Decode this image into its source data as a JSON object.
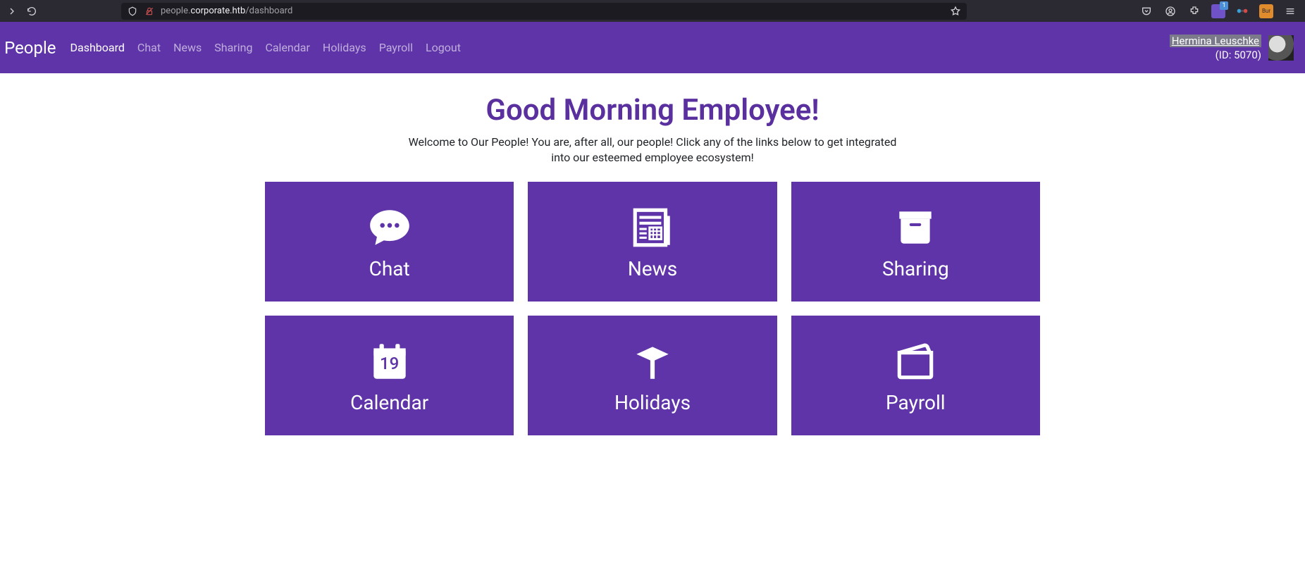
{
  "browser": {
    "url_prefix": "people.",
    "url_host": "corporate.htb",
    "url_path": "/dashboard",
    "ext_badge_count": "1",
    "ext_orange_label": "Bur"
  },
  "nav": {
    "brand": "r People",
    "links": [
      {
        "label": "Dashboard",
        "active": true
      },
      {
        "label": "Chat",
        "active": false
      },
      {
        "label": "News",
        "active": false
      },
      {
        "label": "Sharing",
        "active": false
      },
      {
        "label": "Calendar",
        "active": false
      },
      {
        "label": "Holidays",
        "active": false
      },
      {
        "label": "Payroll",
        "active": false
      },
      {
        "label": "Logout",
        "active": false
      }
    ],
    "user": {
      "name": "Hermina Leuschke",
      "id_label": "(ID: 5070)"
    }
  },
  "main": {
    "headline": "Good Morning Employee!",
    "subhead": "Welcome to Our People! You are, after all, our people! Click any of the links below to get integrated into our esteemed employee ecosystem!",
    "cards": [
      {
        "label": "Chat",
        "icon": "chat-icon"
      },
      {
        "label": "News",
        "icon": "news-icon"
      },
      {
        "label": "Sharing",
        "icon": "sharing-icon"
      },
      {
        "label": "Calendar",
        "icon": "calendar-icon",
        "day": "19"
      },
      {
        "label": "Holidays",
        "icon": "holidays-icon"
      },
      {
        "label": "Payroll",
        "icon": "payroll-icon"
      }
    ]
  }
}
